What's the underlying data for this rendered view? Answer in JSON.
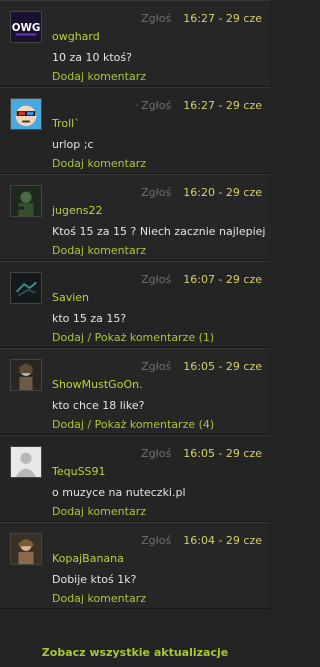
{
  "posts": [
    {
      "user": "owghard",
      "text": "10 za 10 ktoś?",
      "report": "Zgłoś",
      "time": "16:27 - 29 cze",
      "action": "Dodaj komentarz",
      "dot": ""
    },
    {
      "user": "Troll`",
      "text": "urlop ;c",
      "report": "Zgłoś",
      "time": "16:27 - 29 cze",
      "action": "Dodaj komentarz",
      "dot": "·"
    },
    {
      "user": "jugens22",
      "text": "Ktoś 15 za 15 ? Niech zacznie najlepiej",
      "report": "Zgłoś",
      "time": "16:20 - 29 cze",
      "action": "Dodaj komentarz",
      "dot": ""
    },
    {
      "user": "Savien",
      "text": "kto 15 za 15?",
      "report": "Zgłoś",
      "time": "16:07 - 29 cze",
      "action": "Dodaj / Pokaż komentarze (1)",
      "dot": ""
    },
    {
      "user": "ShowMustGoOn.",
      "text": "kto chce 18 like?",
      "report": "Zgłoś",
      "time": "16:05 - 29 cze",
      "action": "Dodaj / Pokaż komentarze (4)",
      "dot": ""
    },
    {
      "user": "TequSS91",
      "text": "o muzyce na nuteczki.pl",
      "report": "Zgłoś",
      "time": "16:05 - 29 cze",
      "action": "Dodaj komentarz",
      "dot": ""
    },
    {
      "user": "KopajBanana",
      "text": "Dobije ktoś 1k?",
      "report": "Zgłoś",
      "time": "16:04 - 29 cze",
      "action": "Dodaj komentarz",
      "dot": ""
    }
  ],
  "see_all": "Zobacz wszystkie aktualizacje",
  "avatar_logo_text": "OWG",
  "colors": {
    "username": "#b6d43c",
    "time": "#d4d06b",
    "link": "#a9c837"
  }
}
